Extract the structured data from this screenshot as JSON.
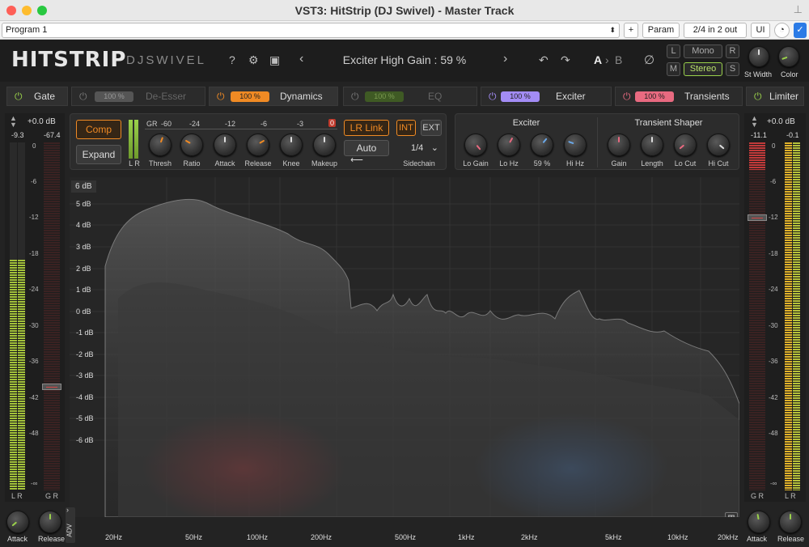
{
  "window": {
    "title": "VST3: HitStrip (DJ Swivel) - Master Track",
    "dots": [
      "#fe5f57",
      "#febc2e",
      "#28c840"
    ]
  },
  "host": {
    "program": "Program 1",
    "plus": "+",
    "param": "Param",
    "io": "2/4 in 2 out",
    "ui": "UI",
    "checked": true
  },
  "header": {
    "logo": "HITSTRIP",
    "brand": "DJSWIVEL",
    "help": "?",
    "preset": "Exciter High Gain : 59 %",
    "ab": "A",
    "ab_arrow": "›",
    "ab_b": "B",
    "channel": {
      "l": "L",
      "r": "R",
      "m": "M",
      "s": "S",
      "mono": "Mono",
      "stereo": "Stereo"
    },
    "st_width": "St Width",
    "color": "Color"
  },
  "modules": [
    {
      "label": "Gate",
      "pct": "",
      "enabled": true,
      "color": "#9ad14b"
    },
    {
      "label": "De-Esser",
      "pct": "100 %",
      "enabled": false,
      "color": "#555555"
    },
    {
      "label": "Dynamics",
      "pct": "100 %",
      "enabled": true,
      "color": "#f08a24"
    },
    {
      "label": "EQ",
      "pct": "100 %",
      "enabled": false,
      "color": "#4a6a2a"
    },
    {
      "label": "Exciter",
      "pct": "100 %",
      "enabled": true,
      "color": "#a38cf5"
    },
    {
      "label": "Transients",
      "pct": "100 %",
      "enabled": true,
      "color": "#e86a80"
    },
    {
      "label": "Limiter",
      "pct": "",
      "enabled": true,
      "color": "#9ad14b"
    }
  ],
  "dynamics": {
    "comp": "Comp",
    "expand": "Expand",
    "gr": "GR",
    "gr_scale": [
      "-60",
      "-24",
      "-12",
      "-6",
      "-3",
      "0"
    ],
    "lr": "L R",
    "knobs": [
      "Thresh",
      "Ratio",
      "Attack",
      "Release",
      "Knee",
      "Makeup"
    ],
    "lr_link": "LR Link",
    "auto": "Auto",
    "int": "INT",
    "ext": "EXT",
    "sidechain_value": "1/4",
    "sidechain": "Sidechain"
  },
  "exciter": {
    "title": "Exciter",
    "knobs": [
      "Lo Gain",
      "Lo Hz",
      "59 %",
      "Hi Hz"
    ]
  },
  "transient": {
    "title": "Transient Shaper",
    "knobs": [
      "Gain",
      "Length",
      "Lo Cut",
      "Hi Cut"
    ]
  },
  "input_meter": {
    "gain": "+0.0 dB",
    "peak_l": "-9.3",
    "peak_r": "-67.4",
    "scale": [
      "0",
      "-6",
      "-12",
      "-18",
      "-24",
      "-30",
      "-36",
      "-42",
      "-48",
      "-∞"
    ],
    "foot_l": "L R",
    "foot_r": "G R",
    "attack": "Attack",
    "release": "Release",
    "adv": "ADV"
  },
  "output_meter": {
    "gain": "+0.0 dB",
    "peak_l": "-11.1",
    "peak_r": "-0.1",
    "scale": [
      "0",
      "-6",
      "-12",
      "-18",
      "-24",
      "-30",
      "-36",
      "-42",
      "-48",
      "-∞"
    ],
    "foot_l": "G R",
    "foot_r": "L R",
    "attack": "Attack",
    "release": "Release"
  },
  "analyzer": {
    "range": "6 dB",
    "db_labels": [
      "5 dB",
      "4 dB",
      "3 dB",
      "2 dB",
      "1 dB",
      "0 dB",
      "-1 dB",
      "-2 dB",
      "-3 dB",
      "-4 dB",
      "-5 dB",
      "-6 dB"
    ],
    "freq_labels": [
      "20Hz",
      "50Hz",
      "100Hz",
      "200Hz",
      "500Hz",
      "1kHz",
      "2kHz",
      "5kHz",
      "10kHz",
      "20kHz"
    ]
  }
}
